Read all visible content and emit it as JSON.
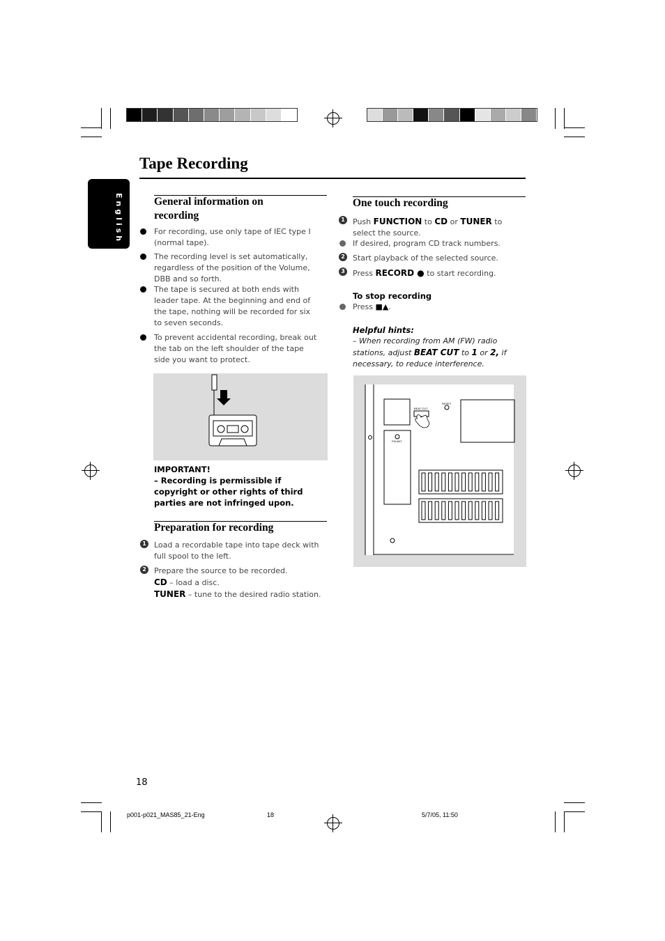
{
  "title": "Tape Recording",
  "language_tab": "English",
  "general": {
    "heading": "General information on recording",
    "items": [
      "For recording, use only tape of IEC type I (normal tape).",
      "The recording level is set automatically, regardless of the position of the Volume, DBB and so forth.",
      "The tape is secured at both ends with leader tape.  At the beginning and end of the tape, nothing will be recorded for six to seven seconds.",
      "To prevent accidental recording, break out the tab on the left shoulder of the tape side you want to protect."
    ],
    "important_label": "IMPORTANT!",
    "important_text": "–   Recording is permissible if copyright or other rights of third parties are not infringed upon."
  },
  "preparation": {
    "heading": "Preparation for recording",
    "step1": "Load a recordable tape into tape deck with full spool to the left.",
    "step2": "Prepare the source to be recorded.",
    "cd_label": "CD",
    "cd_text": " – load a disc.",
    "tuner_label": "TUNER",
    "tuner_text": " – tune to the desired radio station."
  },
  "one_touch": {
    "heading": "One touch recording",
    "s1_a": "Push ",
    "s1_b": "FUNCTION",
    "s1_c": "  to  ",
    "s1_d": "CD",
    "s1_e": "  or ",
    "s1_f": "TUNER",
    "s1_g": " to select the source.",
    "bullet": "If desired, program CD track numbers.",
    "s2": "Start playback of the selected source.",
    "s3_a": "Press ",
    "s3_b": "RECORD ●",
    "s3_c": "  to start recording.",
    "stop_heading": "To stop recording",
    "stop_a": "Press ",
    "stop_b": "■▲",
    "stop_c": ".",
    "hints_heading": "Helpful hints:",
    "hints_a": "–  When recording from AM (FW) radio stations, adjust ",
    "hints_b": "BEAT CUT",
    "hints_c": " to ",
    "hints_d": "1",
    "hints_e": " or ",
    "hints_f": "2,",
    "hints_g": " if necessary, to reduce interference."
  },
  "diagram_labels": {
    "beat_cut": "BEAT CUT",
    "reset": "RESET",
    "fm_ant": "FM ANT"
  },
  "page_number": "18",
  "footer": {
    "file": "p001-p021_MAS85_21-Eng",
    "page": "18",
    "date": "5/7/05, 11:50"
  },
  "colors": {
    "left_bar": [
      "#000",
      "#1e1e1e",
      "#333",
      "#555",
      "#6e6e6e",
      "#8a8a8a",
      "#9e9e9e",
      "#b4b4b4",
      "#c8c8c8",
      "#ddd",
      "#fff"
    ],
    "right_bar": [
      "#ddd",
      "#999",
      "#bbb",
      "#111",
      "#888",
      "#555",
      "#000",
      "#e5e5e5",
      "#aaa",
      "#ccc",
      "#888"
    ],
    "figure_bg": "#dcdcdc"
  }
}
